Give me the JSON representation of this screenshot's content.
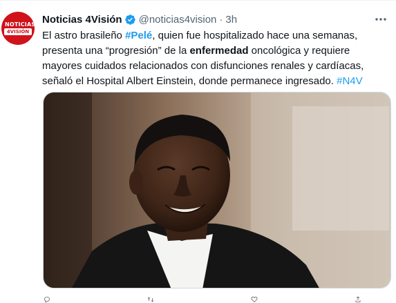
{
  "tweet": {
    "author": {
      "display_name": "Noticias 4Visión",
      "handle": "@noticias4vision",
      "verified": true,
      "avatar_logo_top": "NOTICIAS",
      "avatar_logo_bottom": "4VISIÓN"
    },
    "separator": "·",
    "timestamp": "3h",
    "more_icon": "more-horizontal-icon",
    "body_lines": [
      {
        "part1": "El astro brasileño ",
        "hashtag": "#Pelé",
        "part2": ", quien fue hospitalizado hace una semanas,"
      },
      {
        "part1": "presenta una “progresión” de la ",
        "bold": "enfermedad",
        "part2": " oncológica y requiere"
      },
      {
        "text": "mayores cuidados relacionados con disfunciones renales y cardíacas,"
      },
      {
        "part1": "señaló el Hospital Albert Einstein, donde permanece ingresado. ",
        "hashtag": "#N4V"
      }
    ],
    "media": {
      "type": "photo",
      "subject": "portrait of Pelé smiling"
    },
    "actions": [
      {
        "name": "reply",
        "icon": "reply-icon"
      },
      {
        "name": "retweet",
        "icon": "retweet-icon"
      },
      {
        "name": "like",
        "icon": "like-icon"
      },
      {
        "name": "share",
        "icon": "share-icon"
      }
    ]
  },
  "colors": {
    "text_primary": "#0f1419",
    "text_secondary": "#536471",
    "link": "#1d9bf0",
    "avatar_red": "#d0121b",
    "border": "#cfd9de"
  }
}
